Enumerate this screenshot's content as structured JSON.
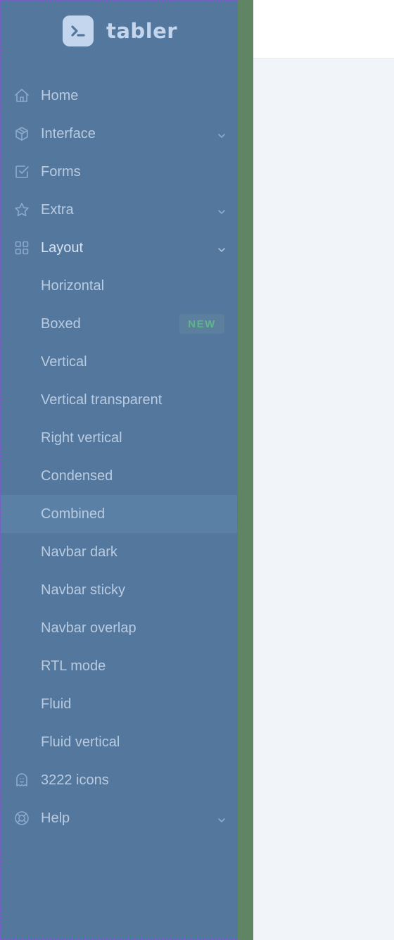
{
  "brand": {
    "name": "tabler",
    "logo_icon": "terminal-prompt-icon"
  },
  "sidebar": {
    "items": [
      {
        "label": "Home",
        "icon": "home-icon"
      },
      {
        "label": "Interface",
        "icon": "package-icon",
        "chevron": true
      },
      {
        "label": "Forms",
        "icon": "checkbox-icon"
      },
      {
        "label": "Extra",
        "icon": "star-icon",
        "chevron": true
      },
      {
        "label": "Layout",
        "icon": "layout-grid-icon",
        "chevron": true,
        "expanded": true
      }
    ],
    "layout_submenu": [
      {
        "label": "Horizontal"
      },
      {
        "label": "Boxed",
        "badge": "NEW"
      },
      {
        "label": "Vertical"
      },
      {
        "label": "Vertical transparent"
      },
      {
        "label": "Right vertical"
      },
      {
        "label": "Condensed"
      },
      {
        "label": "Combined",
        "highlighted": true
      },
      {
        "label": "Navbar dark"
      },
      {
        "label": "Navbar sticky"
      },
      {
        "label": "Navbar overlap"
      },
      {
        "label": "RTL mode"
      },
      {
        "label": "Fluid"
      },
      {
        "label": "Fluid vertical"
      }
    ],
    "bottom_items": [
      {
        "label": "3222 icons",
        "icon": "ghost-icon"
      },
      {
        "label": "Help",
        "icon": "lifebuoy-icon",
        "chevron": true
      }
    ]
  },
  "colors": {
    "sidebar_bg": "#54779e",
    "nav_text": "#b9cbe0",
    "badge_text": "#5fb58a",
    "content_bg": "#f1f4f8",
    "strip": "#5f8564"
  }
}
